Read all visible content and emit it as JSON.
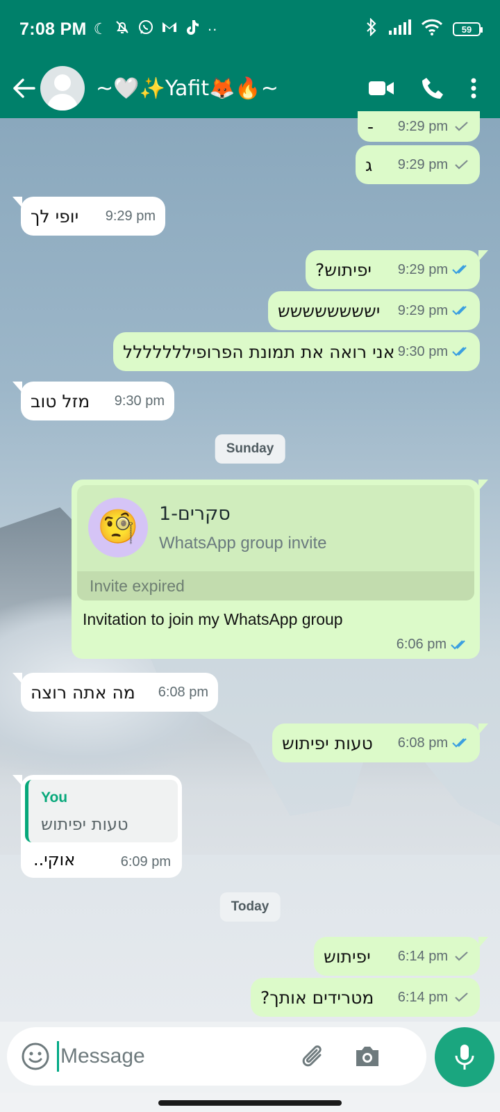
{
  "status": {
    "time": "7:08 PM",
    "battery": "59",
    "more_glyph": "··"
  },
  "header": {
    "contact_name": "~🤍✨Yafit🦊🔥~"
  },
  "messages": [
    {
      "dir": "out",
      "text": "-",
      "time": "9:29 pm",
      "ticks": "single-grey"
    },
    {
      "dir": "out",
      "text": "ג",
      "time": "9:29 pm",
      "ticks": "single-grey"
    },
    {
      "dir": "in",
      "text": "יופי לך",
      "time": "9:29 pm"
    },
    {
      "dir": "out",
      "text": "יפיתוש?",
      "time": "9:29 pm",
      "ticks": "double-blue"
    },
    {
      "dir": "out",
      "text": "ישששששששש",
      "time": "9:29 pm",
      "ticks": "double-blue"
    },
    {
      "dir": "out",
      "text": "אני רואה את תמונת הפרופיללללללל",
      "time": "9:30 pm",
      "ticks": "double-blue"
    },
    {
      "dir": "in",
      "text": "מזל טוב",
      "time": "9:30 pm"
    },
    {
      "dir": "in",
      "text": "מה אתה רוצה",
      "time": "6:08 pm"
    },
    {
      "dir": "out",
      "text": "טעות יפיתוש",
      "time": "6:08 pm",
      "ticks": "double-blue"
    },
    {
      "dir": "out",
      "text": "יפיתוש",
      "time": "6:14 pm",
      "ticks": "single-grey"
    },
    {
      "dir": "out",
      "text": "מטרידים אותך?",
      "time": "6:14 pm",
      "ticks": "single-grey"
    }
  ],
  "days": {
    "sunday": "Sunday",
    "today": "Today"
  },
  "invite": {
    "group_name": "סקרים-1",
    "subtitle": "WhatsApp group invite",
    "status": "Invite expired",
    "body": "Invitation to join my WhatsApp group",
    "time": "6:06 pm",
    "ticks": "double-blue",
    "emoji": "🧐"
  },
  "reply": {
    "quote_author": "You",
    "quote_text": "טעות יפיתוש",
    "text": "אוקי..",
    "time": "6:09 pm"
  },
  "composer": {
    "placeholder": "Message"
  },
  "colors": {
    "header": "#00806a",
    "outgoing": "#dcfac9",
    "incoming": "#ffffff",
    "read_tick": "#3b9fe0",
    "mic": "#1aa67f"
  }
}
